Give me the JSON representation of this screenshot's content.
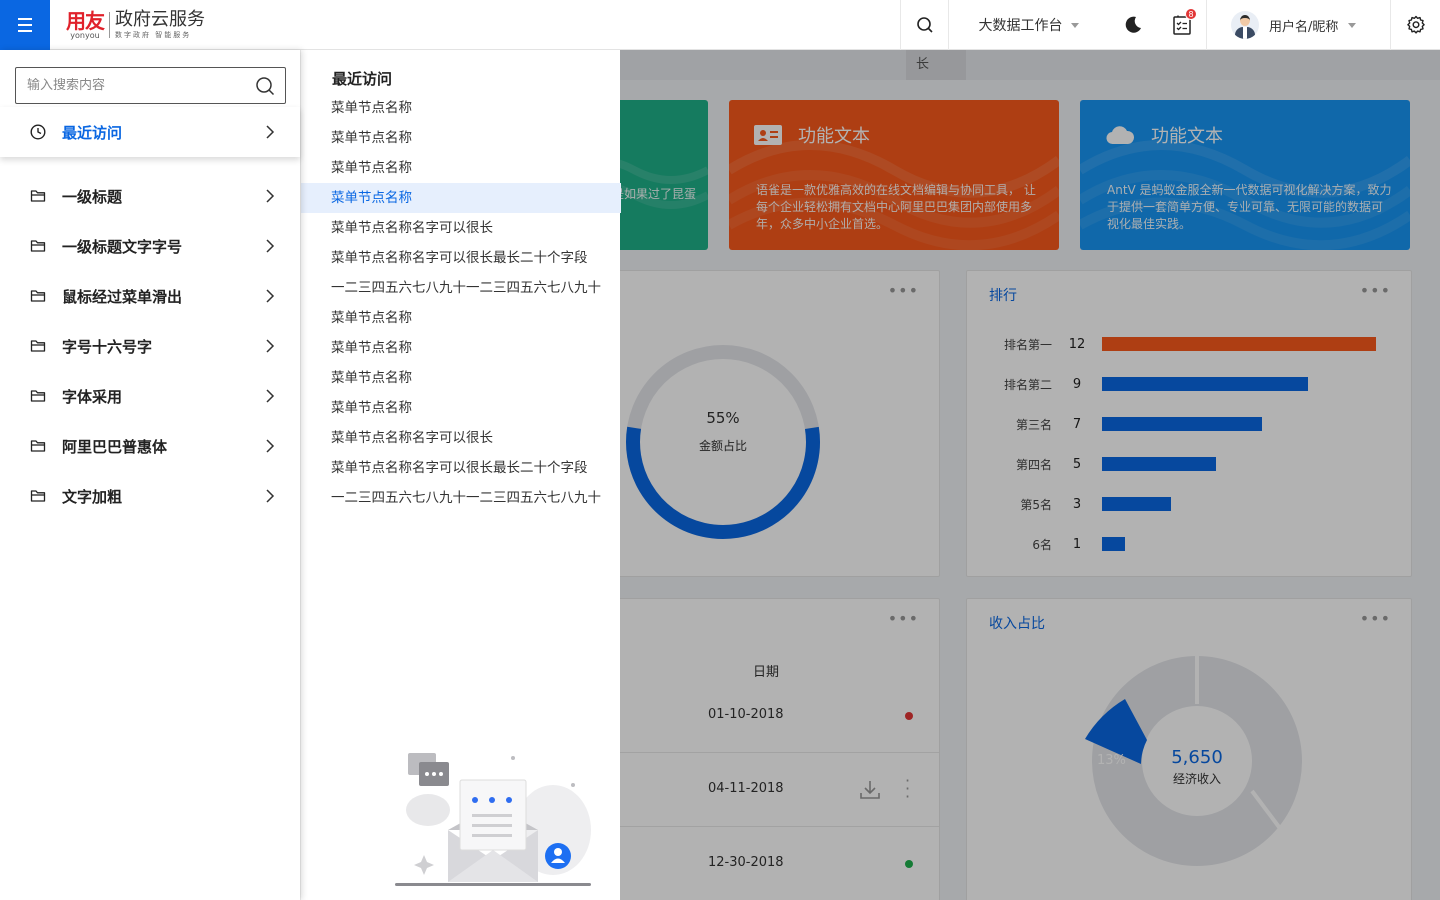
{
  "topbar": {
    "brand_cn": "用友",
    "brand_en": "yonyou",
    "product_name": "政府云服务",
    "product_slogan": "数字政府 智能服务",
    "workbench_label": "大数据工作台",
    "todo_badge": "8",
    "user_name": "用户名/昵称"
  },
  "nav": {
    "search_placeholder": "输入搜索内容",
    "items": [
      {
        "label": "最近访问",
        "icon": "clock-icon",
        "active": true
      },
      {
        "label": "一级标题",
        "icon": "folder-icon"
      },
      {
        "label": "一级标题文字字号",
        "icon": "folder-icon"
      },
      {
        "label": "鼠标经过菜单滑出",
        "icon": "folder-icon"
      },
      {
        "label": "字号十六号字",
        "icon": "folder-icon"
      },
      {
        "label": "字体采用",
        "icon": "folder-icon"
      },
      {
        "label": "阿里巴巴普惠体",
        "icon": "folder-icon"
      },
      {
        "label": "文字加粗",
        "icon": "folder-icon"
      }
    ]
  },
  "submenu": {
    "title": "最近访问",
    "items": [
      "菜单节点名称",
      "菜单节点名称",
      "菜单节点名称",
      "菜单节点名称",
      "菜单节点名称名字可以很长",
      "菜单节点名称名字可以很长最长二十个字段",
      "一二三四五六七八九十一二三四五六七八九十",
      "菜单节点名称",
      "菜单节点名称",
      "菜单节点名称",
      "菜单节点名称",
      "菜单节点名称名字可以很长",
      "菜单节点名称名字可以很长最长二十个字段",
      "一二三四五六七八九十一二三四五六七八九十"
    ],
    "highlighted_index": 3
  },
  "dashboard": {
    "tab_partial": "长",
    "cards": [
      {
        "title": "",
        "text": "是如果过了昆蛋",
        "color": "#1fb089"
      },
      {
        "title": "功能文本",
        "text": "语雀是一款优雅高效的在线文档编辑与协同工具， 让每个企业轻松拥有文档中心阿里巴巴集团内部使用多年，众多中小企业首选。",
        "icon": "id-card-icon",
        "color": "#fa5a1c"
      },
      {
        "title": "功能文本",
        "text": "AntV 是蚂蚁金服全新一代数据可视化解决方案，致力于提供一套简单方便、专业可靠、无限可能的数据可视化最佳实践。",
        "icon": "cloud-icon",
        "color": "#1896f4"
      }
    ],
    "donut1": {
      "percent": 55,
      "value_label": "55%",
      "caption": "金额占比"
    },
    "ranking": {
      "title": "排行",
      "rows": [
        {
          "label": "排名第一",
          "value": 12,
          "color": "#fa5a1c"
        },
        {
          "label": "排名第二",
          "value": 9,
          "color": "#0a67e2"
        },
        {
          "label": "第三名",
          "value": 7,
          "color": "#0a67e2"
        },
        {
          "label": "第四名",
          "value": 5,
          "color": "#0a67e2"
        },
        {
          "label": "第5名",
          "value": 3,
          "color": "#0a67e2"
        },
        {
          "label": "6名",
          "value": 1,
          "color": "#0a67e2"
        }
      ]
    },
    "table": {
      "date_header": "日期",
      "rows": [
        {
          "date": "01-10-2018",
          "status_color": "#e23636"
        },
        {
          "date": "04-11-2018",
          "status_color": ""
        },
        {
          "date": "12-30-2018",
          "status_color": "#1fb04d"
        }
      ]
    },
    "income": {
      "title": "收入占比",
      "slice_label": "13%",
      "center_value": "5,650",
      "center_caption": "经济收入"
    }
  }
}
